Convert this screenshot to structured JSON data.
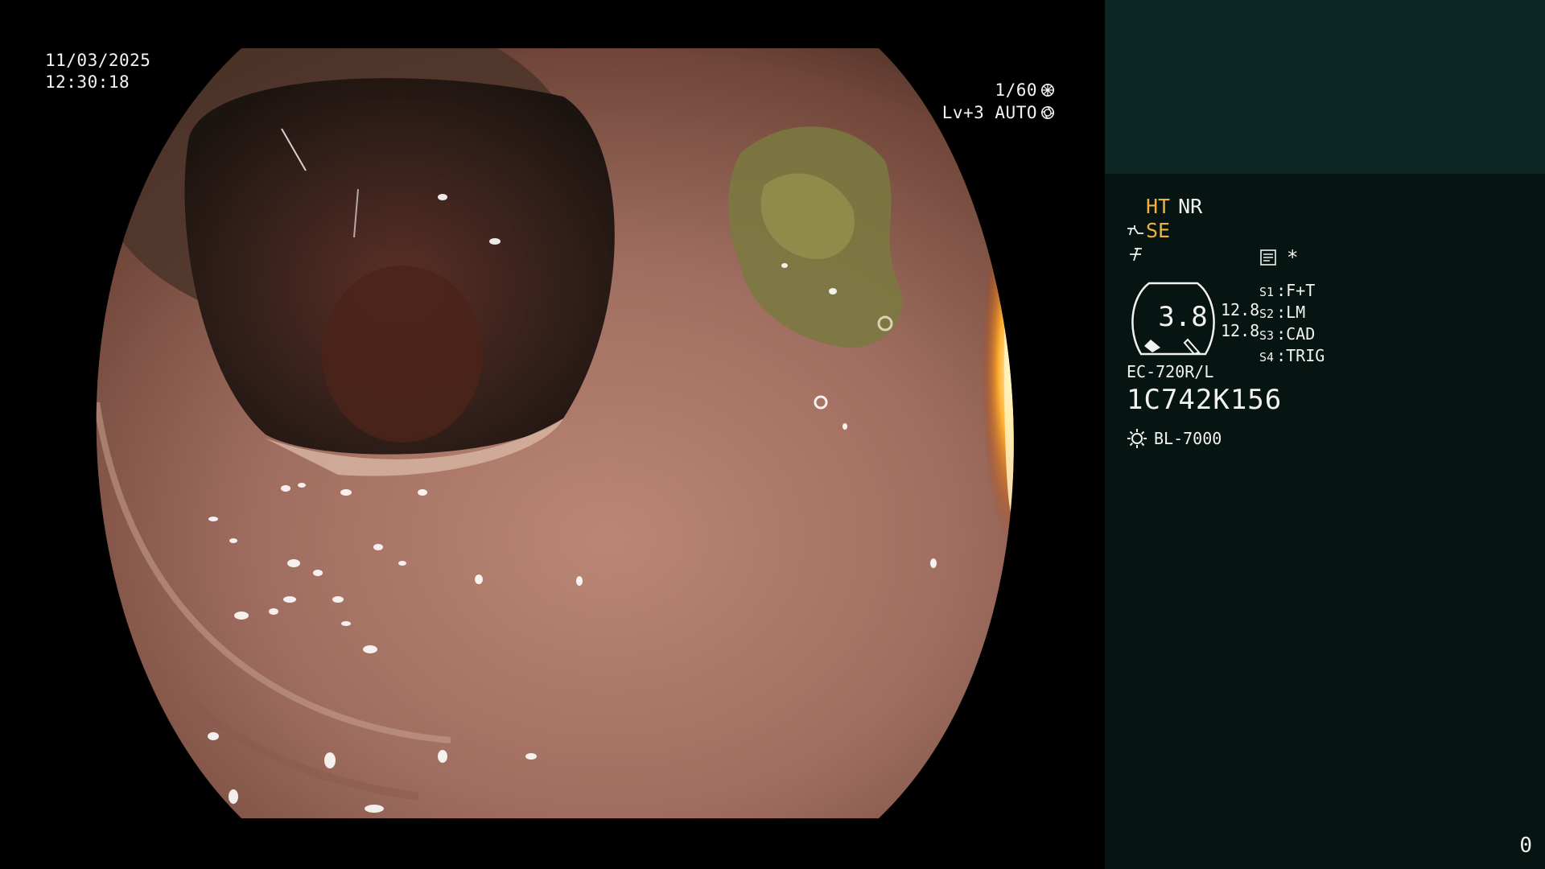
{
  "video": {
    "date": "11/03/2025",
    "time": "12:30:18",
    "shutter": "1/60",
    "iris": "Lv+3 AUTO"
  },
  "panel": {
    "ht": "HT",
    "nr": "NR",
    "se": "SE",
    "memo_star": "*",
    "gauge_value": "3.8",
    "gauge_num_1": "12.8",
    "gauge_num_2": "12.8",
    "switches": [
      {
        "key": "S1",
        "value": "F+T"
      },
      {
        "key": "S2",
        "value": "LM"
      },
      {
        "key": "S3",
        "value": "CAD"
      },
      {
        "key": "S4",
        "value": "TRIG"
      }
    ],
    "scope_model": "EC-720R/L",
    "scope_serial": "1C742K156",
    "light_source": "BL-7000",
    "counter": "0"
  },
  "colors": {
    "panel_bg": "#061512",
    "panel_top_bg": "#0d2724",
    "highlight": "#f3b13a"
  },
  "icons": [
    "shutter-icon",
    "iris-icon",
    "enhance-icon",
    "sharpness-icon",
    "memo-icon",
    "light-icon"
  ]
}
